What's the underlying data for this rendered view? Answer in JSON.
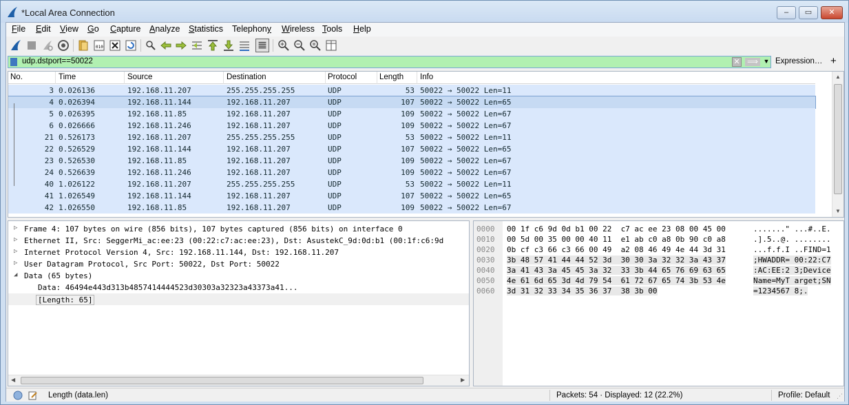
{
  "window": {
    "title": "*Local Area Connection",
    "minimize_label": "‒",
    "maximize_label": "▭",
    "close_label": "✕"
  },
  "menu": {
    "items": [
      {
        "label": "File",
        "accel": "F"
      },
      {
        "label": "Edit",
        "accel": "E"
      },
      {
        "label": "View",
        "accel": "V"
      },
      {
        "label": "Go",
        "accel": "G"
      },
      {
        "label": "Capture",
        "accel": "C"
      },
      {
        "label": "Analyze",
        "accel": "A"
      },
      {
        "label": "Statistics",
        "accel": "S"
      },
      {
        "label": "Telephony",
        "accel": "y"
      },
      {
        "label": "Wireless",
        "accel": "W"
      },
      {
        "label": "Tools",
        "accel": "T"
      },
      {
        "label": "Help",
        "accel": "H"
      }
    ]
  },
  "toolbar": {
    "icons": [
      "shark-fin-start-icon",
      "stop-icon",
      "restart-icon",
      "capture-options-icon",
      "open-file-icon",
      "save-file-icon",
      "close-file-icon",
      "reload-icon",
      "find-packet-icon",
      "go-back-icon",
      "go-forward-icon",
      "go-to-packet-icon",
      "first-packet-icon",
      "last-packet-icon",
      "auto-scroll-icon",
      "colorize-icon",
      "zoom-in-icon",
      "zoom-out-icon",
      "normal-size-icon",
      "resize-columns-icon"
    ]
  },
  "filter": {
    "value": "udp.dstport==50022",
    "expression_label": "Expression…",
    "plus_label": "+",
    "color": "#b1f0b1"
  },
  "packet_list": {
    "columns": [
      "No.",
      "Time",
      "Source",
      "Destination",
      "Protocol",
      "Length",
      "Info"
    ],
    "rows": [
      {
        "no": "3",
        "time": "0.026136",
        "src": "192.168.11.207",
        "dst": "255.255.255.255",
        "proto": "UDP",
        "len": "53",
        "info": "50022 → 50022 Len=11"
      },
      {
        "no": "4",
        "time": "0.026394",
        "src": "192.168.11.144",
        "dst": "192.168.11.207",
        "proto": "UDP",
        "len": "107",
        "info": "50022 → 50022 Len=65"
      },
      {
        "no": "5",
        "time": "0.026395",
        "src": "192.168.11.85",
        "dst": "192.168.11.207",
        "proto": "UDP",
        "len": "109",
        "info": "50022 → 50022 Len=67"
      },
      {
        "no": "6",
        "time": "0.026666",
        "src": "192.168.11.246",
        "dst": "192.168.11.207",
        "proto": "UDP",
        "len": "109",
        "info": "50022 → 50022 Len=67"
      },
      {
        "no": "21",
        "time": "0.526173",
        "src": "192.168.11.207",
        "dst": "255.255.255.255",
        "proto": "UDP",
        "len": "53",
        "info": "50022 → 50022 Len=11"
      },
      {
        "no": "22",
        "time": "0.526529",
        "src": "192.168.11.144",
        "dst": "192.168.11.207",
        "proto": "UDP",
        "len": "107",
        "info": "50022 → 50022 Len=65"
      },
      {
        "no": "23",
        "time": "0.526530",
        "src": "192.168.11.85",
        "dst": "192.168.11.207",
        "proto": "UDP",
        "len": "109",
        "info": "50022 → 50022 Len=67"
      },
      {
        "no": "24",
        "time": "0.526639",
        "src": "192.168.11.246",
        "dst": "192.168.11.207",
        "proto": "UDP",
        "len": "109",
        "info": "50022 → 50022 Len=67"
      },
      {
        "no": "40",
        "time": "1.026122",
        "src": "192.168.11.207",
        "dst": "255.255.255.255",
        "proto": "UDP",
        "len": "53",
        "info": "50022 → 50022 Len=11"
      },
      {
        "no": "41",
        "time": "1.026549",
        "src": "192.168.11.144",
        "dst": "192.168.11.207",
        "proto": "UDP",
        "len": "107",
        "info": "50022 → 50022 Len=65"
      },
      {
        "no": "42",
        "time": "1.026550",
        "src": "192.168.11.85",
        "dst": "192.168.11.207",
        "proto": "UDP",
        "len": "109",
        "info": "50022 → 50022 Len=67"
      }
    ],
    "selected_no": "4",
    "row_color": "#dae8fc"
  },
  "details": {
    "items": [
      {
        "arrow": "▷",
        "text": "Frame 4: 107 bytes on wire (856 bits), 107 bytes captured (856 bits) on interface 0"
      },
      {
        "arrow": "▷",
        "text": "Ethernet II, Src: SeggerMi_ac:ee:23 (00:22:c7:ac:ee:23), Dst: AsustekC_9d:0d:b1 (00:1f:c6:9d"
      },
      {
        "arrow": "▷",
        "text": "Internet Protocol Version 4, Src: 192.168.11.144, Dst: 192.168.11.207"
      },
      {
        "arrow": "▷",
        "text": "User Datagram Protocol, Src Port: 50022, Dst Port: 50022"
      },
      {
        "arrow": "◢",
        "text": "Data (65 bytes)"
      }
    ],
    "data_line": "Data: 46494e443d313b4857414444523d30303a32323a43373a41...",
    "length_line": "[Length: 65]"
  },
  "bytes": {
    "rows": [
      {
        "offset": "0000",
        "hex": "00 1f c6 9d 0d b1 00 22  c7 ac ee 23 08 00 45 00",
        "ascii": ".......\" ...#..E."
      },
      {
        "offset": "0010",
        "hex": "00 5d 00 35 00 00 40 11  e1 ab c0 a8 0b 90 c0 a8",
        "ascii": ".].5..@. ........"
      },
      {
        "offset": "0020",
        "hex": "0b cf c3 66 c3 66 00 49  a2 08 46 49 4e 44 3d 31",
        "ascii": "...f.f.I ..FIND=1"
      },
      {
        "offset": "0030",
        "hex": "3b 48 57 41 44 44 52 3d  30 30 3a 32 32 3a 43 37",
        "ascii": ";HWADDR= 00:22:C7"
      },
      {
        "offset": "0040",
        "hex": "3a 41 43 3a 45 45 3a 32  33 3b 44 65 76 69 63 65",
        "ascii": ":AC:EE:2 3;Device"
      },
      {
        "offset": "0050",
        "hex": "4e 61 6d 65 3d 4d 79 54  61 72 67 65 74 3b 53 4e",
        "ascii": "Name=MyT arget;SN"
      },
      {
        "offset": "0060",
        "hex": "3d 31 32 33 34 35 36 37  38 3b 00",
        "ascii": "=1234567 8;."
      }
    ]
  },
  "status": {
    "field_label": "Length (data.len)",
    "packets": "Packets: 54 · Displayed: 12 (22.2%)",
    "profile": "Profile: Default"
  }
}
